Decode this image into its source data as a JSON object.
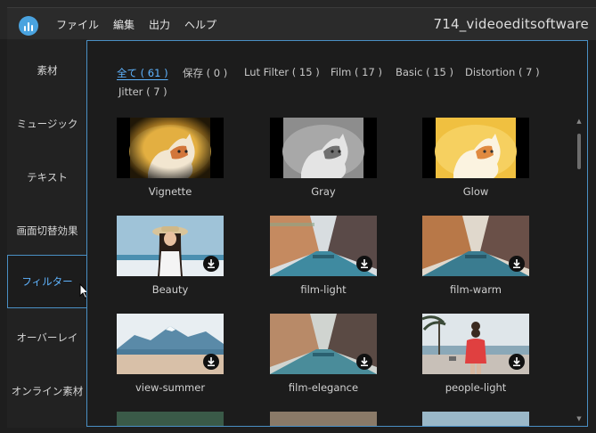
{
  "menu": {
    "items": [
      "ファイル",
      "編集",
      "出力",
      "ヘルプ"
    ]
  },
  "app_title": "714_videoeditsoftware",
  "sidebar": {
    "items": [
      {
        "label": "素材"
      },
      {
        "label": "ミュージック"
      },
      {
        "label": "テキスト"
      },
      {
        "label": "画面切替効果"
      },
      {
        "label": "フィルター"
      },
      {
        "label": "オーバーレイ"
      },
      {
        "label": "オンライン素材"
      }
    ],
    "active_index": 4
  },
  "tabs": [
    {
      "label": "全て ( 61 )"
    },
    {
      "label": "保存 ( 0 )"
    },
    {
      "label": "Lut Filter ( 15 )"
    },
    {
      "label": "Film ( 17 )"
    },
    {
      "label": "Basic ( 15 )"
    },
    {
      "label": "Distortion ( 7 )"
    },
    {
      "label": "Jitter ( 7 )"
    }
  ],
  "filters": [
    {
      "label": "Vignette",
      "kind": "cat-vignette",
      "download": false
    },
    {
      "label": "Gray",
      "kind": "cat-gray",
      "download": false
    },
    {
      "label": "Glow",
      "kind": "cat-glow",
      "download": false
    },
    {
      "label": "Beauty",
      "kind": "portrait",
      "download": true
    },
    {
      "label": "film-light",
      "kind": "street-light",
      "download": true
    },
    {
      "label": "film-warm",
      "kind": "street-warm",
      "download": true
    },
    {
      "label": "view-summer",
      "kind": "mountain",
      "download": true
    },
    {
      "label": "film-elegance",
      "kind": "street-elegance",
      "download": true
    },
    {
      "label": "people-light",
      "kind": "beach",
      "download": true
    }
  ],
  "colors": {
    "accent": "#5fb4ff",
    "border_accent": "#4a8fc4"
  }
}
